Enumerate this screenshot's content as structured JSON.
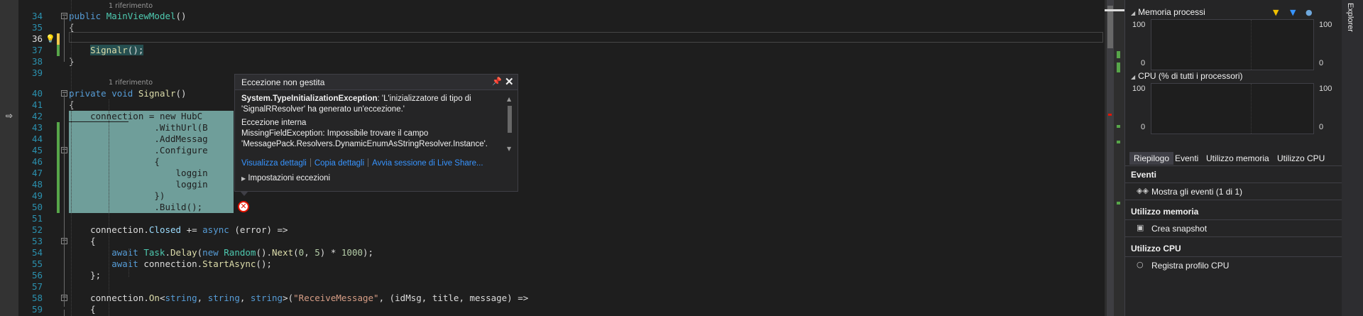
{
  "editor": {
    "codelens_references": "1 riferimento",
    "lines": [
      {
        "n": "34",
        "code": [
          [
            "k",
            "public "
          ],
          [
            "t",
            "MainViewModel"
          ],
          [
            "p",
            "()"
          ]
        ]
      },
      {
        "n": "35",
        "code": [
          [
            "p",
            "{"
          ]
        ]
      },
      {
        "n": "36",
        "code": []
      },
      {
        "n": "37",
        "code": [
          [
            "m",
            "Signalr"
          ],
          [
            "p",
            "();"
          ]
        ]
      },
      {
        "n": "38",
        "code": [
          [
            "p",
            "}"
          ]
        ]
      },
      {
        "n": "39",
        "code": []
      },
      {
        "n": "40",
        "code": [
          [
            "k",
            "private void "
          ],
          [
            "m",
            "Signalr"
          ],
          [
            "p",
            "()"
          ]
        ]
      },
      {
        "n": "41",
        "code": [
          [
            "p",
            "{"
          ]
        ]
      },
      {
        "n": "42",
        "code": [
          [
            "p",
            "    connection = "
          ],
          [
            "k",
            "new "
          ],
          [
            "t",
            "HubC"
          ]
        ]
      },
      {
        "n": "43",
        "code": [
          [
            "p",
            "                .WithUrl(B"
          ]
        ]
      },
      {
        "n": "44",
        "code": [
          [
            "p",
            "                .AddMessag"
          ]
        ]
      },
      {
        "n": "45",
        "code": [
          [
            "p",
            "                .Configure"
          ]
        ]
      },
      {
        "n": "46",
        "code": [
          [
            "p",
            "                {"
          ]
        ]
      },
      {
        "n": "47",
        "code": [
          [
            "p",
            "                    loggin"
          ]
        ]
      },
      {
        "n": "48",
        "code": [
          [
            "p",
            "                    loggin"
          ]
        ]
      },
      {
        "n": "49",
        "code": [
          [
            "p",
            "                })"
          ]
        ]
      },
      {
        "n": "50",
        "code": [
          [
            "p",
            "                .Build();"
          ]
        ]
      },
      {
        "n": "51",
        "code": []
      },
      {
        "n": "52",
        "code": [
          [
            "p",
            "    connection."
          ],
          [
            "v",
            "Closed"
          ],
          [
            "p",
            " += "
          ],
          [
            "k",
            "async "
          ],
          [
            "p",
            "(error) =>"
          ]
        ]
      },
      {
        "n": "53",
        "code": [
          [
            "p",
            "    {"
          ]
        ]
      },
      {
        "n": "54",
        "code": [
          [
            "k",
            "        await "
          ],
          [
            "t",
            "Task"
          ],
          [
            "p",
            "."
          ],
          [
            "m",
            "Delay"
          ],
          [
            "p",
            "("
          ],
          [
            "k",
            "new "
          ],
          [
            "t",
            "Random"
          ],
          [
            "p",
            "()."
          ],
          [
            "m",
            "Next"
          ],
          [
            "p",
            "("
          ],
          [
            "n",
            "0"
          ],
          [
            "p",
            ", "
          ],
          [
            "n",
            "5"
          ],
          [
            "p",
            ") * "
          ],
          [
            "n",
            "1000"
          ],
          [
            "p",
            ");"
          ]
        ]
      },
      {
        "n": "55",
        "code": [
          [
            "k",
            "        await "
          ],
          [
            "p",
            "connection."
          ],
          [
            "m",
            "StartAsync"
          ],
          [
            "p",
            "();"
          ]
        ]
      },
      {
        "n": "56",
        "code": [
          [
            "p",
            "    };"
          ]
        ]
      },
      {
        "n": "57",
        "code": []
      },
      {
        "n": "58",
        "code": [
          [
            "p",
            "    connection."
          ],
          [
            "m",
            "On"
          ],
          [
            "p",
            "<"
          ],
          [
            "k",
            "string"
          ],
          [
            "p",
            ", "
          ],
          [
            "k",
            "string"
          ],
          [
            "p",
            ", "
          ],
          [
            "k",
            "string"
          ],
          [
            "p",
            ">("
          ],
          [
            "s",
            "\"ReceiveMessage\""
          ],
          [
            "p",
            ", (idMsg, title, message) =>"
          ]
        ]
      },
      {
        "n": "59",
        "code": [
          [
            "p",
            "    {"
          ]
        ]
      }
    ]
  },
  "exception": {
    "title": "Eccezione non gestita",
    "type": "System.TypeInitializationException",
    "message": ": 'L'inizializzatore di tipo di 'SignalRResolver' ha generato un'eccezione.'",
    "inner_label": "Eccezione interna",
    "inner_text": "MissingFieldException: Impossibile trovare il campo 'MessagePack.Resolvers.DynamicEnumAsStringResolver.Instance'.",
    "links": [
      "Visualizza dettagli",
      "Copia dettagli",
      "Avvia sessione di Live Share..."
    ],
    "settings": "Impostazioni eccezioni"
  },
  "diagnostics": {
    "memory_title": "Memoria processi",
    "memory_ymax_left": "100",
    "memory_ymin_left": "0",
    "memory_ymax_right": "100",
    "memory_ymin_right": "0",
    "cpu_title": "CPU (% di tutti i processori)",
    "cpu_ymax_left": "100",
    "cpu_ymin_left": "0",
    "cpu_ymax_right": "100",
    "cpu_ymin_right": "0",
    "tabs": [
      "Riepilogo",
      "Eventi",
      "Utilizzo memoria",
      "Utilizzo CPU"
    ],
    "events_title": "Eventi",
    "events_item": "Mostra gli eventi (1 di 1)",
    "memory_usage_title": "Utilizzo memoria",
    "snapshot_item": "Crea snapshot",
    "cpu_usage_title": "Utilizzo CPU",
    "cpu_profile_item": "Registra profilo CPU",
    "colors": {
      "flag_yellow": "#f0c000",
      "flag_blue": "#3794ff",
      "accent": "#007acc"
    }
  },
  "right_strip": {
    "label": "Explorer"
  }
}
